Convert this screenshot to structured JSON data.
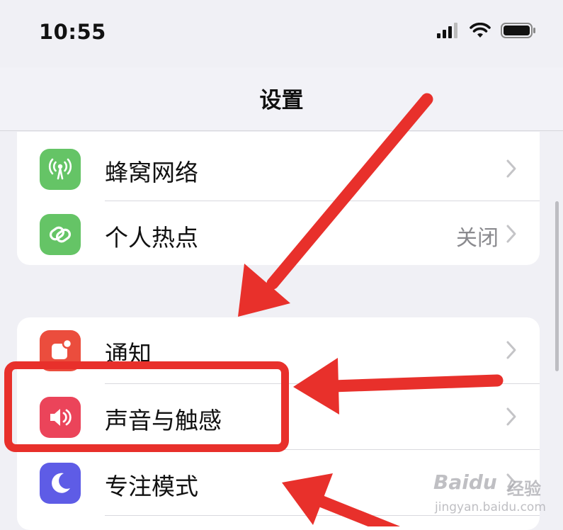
{
  "status_bar": {
    "time": "10:55",
    "icons": [
      "cellular-signal-icon",
      "wifi-icon",
      "battery-icon"
    ]
  },
  "nav": {
    "title": "设置"
  },
  "group1": [
    {
      "label": "蜂窝网络",
      "value": "",
      "icon": "cellular-antenna-icon",
      "icon_color": "#65c466"
    },
    {
      "label": "个人热点",
      "value": "关闭",
      "icon": "hotspot-link-icon",
      "icon_color": "#65c466"
    }
  ],
  "group2": [
    {
      "label": "通知",
      "value": "",
      "icon": "notification-bell-icon",
      "icon_color": "#eb4d3d"
    },
    {
      "label": "声音与触感",
      "value": "",
      "icon": "speaker-icon",
      "icon_color": "#eb445a"
    },
    {
      "label": "专注模式",
      "value": "",
      "icon": "moon-icon",
      "icon_color": "#5e5ce6"
    }
  ],
  "colors": {
    "annotation_red": "#e8302b",
    "background": "#f0f0f5",
    "chevron": "#c4c4c7"
  },
  "watermark": {
    "brand": "Baidu",
    "brand_cn": "经验",
    "url": "jingyan.baidu.com"
  }
}
